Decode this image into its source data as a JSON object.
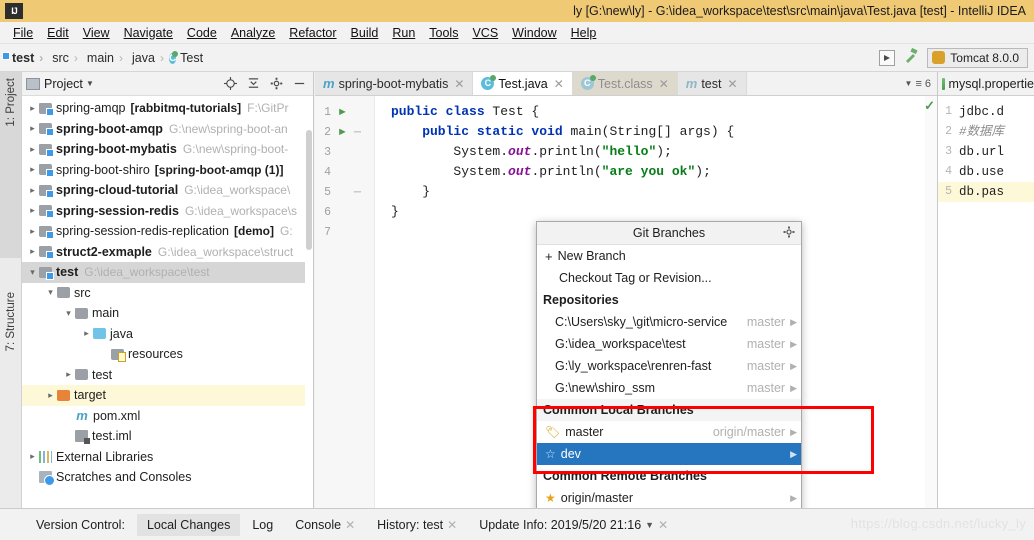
{
  "window": {
    "title": "ly [G:\\new\\ly] - G:\\idea_workspace\\test\\src\\main\\java\\Test.java [test] - IntelliJ IDEA",
    "logo": "IJ"
  },
  "menubar": {
    "items": [
      "File",
      "Edit",
      "View",
      "Navigate",
      "Code",
      "Analyze",
      "Refactor",
      "Build",
      "Run",
      "Tools",
      "VCS",
      "Window",
      "Help"
    ]
  },
  "toolbar": {
    "breadcrumbs": [
      {
        "label": "test",
        "icon": "module-folder-icon",
        "bold": true
      },
      {
        "label": "src",
        "icon": "folder-icon",
        "bold": false
      },
      {
        "label": "main",
        "icon": "folder-icon",
        "bold": false
      },
      {
        "label": "java",
        "icon": "source-folder-icon",
        "bold": false
      },
      {
        "label": "Test",
        "icon": "java-class-icon",
        "bold": false
      }
    ],
    "run_configuration": "Tomcat 8.0.0",
    "run_icon": "run-button-icon",
    "build_icon": "hammer-icon"
  },
  "sidebar_strips": {
    "project_label": "1: Project",
    "structure_label": "7: Structure"
  },
  "project_panel": {
    "header_title": "Project",
    "header_icons": [
      "locate-icon",
      "collapse-all-icon",
      "settings-gear-icon",
      "hide-icon"
    ],
    "tree": [
      {
        "indent": 0,
        "arrow": "collapsed",
        "icon": "module-folder-icon",
        "name": "spring-amqp",
        "name_bold": false,
        "suffix": "[rabbitmq-tutorials]",
        "suffix_bold": true,
        "path": "F:\\GitPr",
        "state": "normal"
      },
      {
        "indent": 0,
        "arrow": "collapsed",
        "icon": "module-folder-icon",
        "name": "spring-boot-amqp",
        "name_bold": true,
        "suffix": "",
        "suffix_bold": false,
        "path": "G:\\new\\spring-boot-an",
        "state": "normal"
      },
      {
        "indent": 0,
        "arrow": "collapsed",
        "icon": "module-folder-icon",
        "name": "spring-boot-mybatis",
        "name_bold": true,
        "suffix": "",
        "suffix_bold": false,
        "path": "G:\\new\\spring-boot-",
        "state": "normal"
      },
      {
        "indent": 0,
        "arrow": "collapsed",
        "icon": "module-folder-icon",
        "name": "spring-boot-shiro",
        "name_bold": false,
        "suffix": "[spring-boot-amqp (1)]",
        "suffix_bold": true,
        "path": "",
        "state": "normal"
      },
      {
        "indent": 0,
        "arrow": "collapsed",
        "icon": "module-folder-icon",
        "name": "spring-cloud-tutorial",
        "name_bold": true,
        "suffix": "",
        "suffix_bold": false,
        "path": "G:\\idea_workspace\\",
        "state": "normal"
      },
      {
        "indent": 0,
        "arrow": "collapsed",
        "icon": "module-folder-icon",
        "name": "spring-session-redis",
        "name_bold": true,
        "suffix": "",
        "suffix_bold": false,
        "path": "G:\\idea_workspace\\s",
        "state": "normal"
      },
      {
        "indent": 0,
        "arrow": "collapsed",
        "icon": "module-folder-icon",
        "name": "spring-session-redis-replication",
        "name_bold": false,
        "suffix": "[demo]",
        "suffix_bold": true,
        "path": "G:",
        "state": "normal"
      },
      {
        "indent": 0,
        "arrow": "collapsed",
        "icon": "module-folder-icon",
        "name": "struct2-exmaple",
        "name_bold": true,
        "suffix": "",
        "suffix_bold": false,
        "path": "G:\\idea_workspace\\struct",
        "state": "normal"
      },
      {
        "indent": 0,
        "arrow": "expanded",
        "icon": "module-folder-icon",
        "name": "test",
        "name_bold": true,
        "suffix": "",
        "suffix_bold": false,
        "path": "G:\\idea_workspace\\test",
        "state": "selected"
      },
      {
        "indent": 1,
        "arrow": "expanded",
        "icon": "folder-icon",
        "name": "src",
        "name_bold": false,
        "suffix": "",
        "suffix_bold": false,
        "path": "",
        "state": "normal"
      },
      {
        "indent": 2,
        "arrow": "expanded",
        "icon": "folder-icon",
        "name": "main",
        "name_bold": false,
        "suffix": "",
        "suffix_bold": false,
        "path": "",
        "state": "normal"
      },
      {
        "indent": 3,
        "arrow": "collapsed",
        "icon": "source-folder-icon",
        "name": "java",
        "name_bold": false,
        "suffix": "",
        "suffix_bold": false,
        "path": "",
        "state": "normal"
      },
      {
        "indent": 4,
        "arrow": "none",
        "icon": "resources-folder-icon",
        "name": "resources",
        "name_bold": false,
        "suffix": "",
        "suffix_bold": false,
        "path": "",
        "state": "normal"
      },
      {
        "indent": 2,
        "arrow": "collapsed",
        "icon": "folder-icon",
        "name": "test",
        "name_bold": false,
        "suffix": "",
        "suffix_bold": false,
        "path": "",
        "state": "normal"
      },
      {
        "indent": 1,
        "arrow": "collapsed",
        "icon": "target-folder-icon",
        "name": "target",
        "name_bold": false,
        "suffix": "",
        "suffix_bold": false,
        "path": "",
        "state": "highlighted"
      },
      {
        "indent": 2,
        "arrow": "none",
        "icon": "maven-xml-icon",
        "name": "pom.xml",
        "name_bold": false,
        "suffix": "",
        "suffix_bold": false,
        "path": "",
        "state": "normal"
      },
      {
        "indent": 2,
        "arrow": "none",
        "icon": "iml-file-icon",
        "name": "test.iml",
        "name_bold": false,
        "suffix": "",
        "suffix_bold": false,
        "path": "",
        "state": "normal"
      },
      {
        "indent": 0,
        "arrow": "collapsed",
        "icon": "libraries-icon",
        "name": "External Libraries",
        "name_bold": false,
        "suffix": "",
        "suffix_bold": false,
        "path": "",
        "state": "normal"
      },
      {
        "indent": 0,
        "arrow": "none",
        "icon": "scratches-icon",
        "name": "Scratches and Consoles",
        "name_bold": false,
        "suffix": "",
        "suffix_bold": false,
        "path": "",
        "state": "normal"
      }
    ]
  },
  "editor": {
    "tabs": [
      {
        "label": "spring-boot-mybatis",
        "icon": "maven-module-icon",
        "state": "inactive"
      },
      {
        "label": "Test.java",
        "icon": "java-class-icon",
        "state": "active"
      },
      {
        "label": "Test.class",
        "icon": "java-class-icon",
        "state": "dimmed"
      },
      {
        "label": "test",
        "icon": "maven-module-icon",
        "state": "inactive"
      }
    ],
    "tab_overflow_count": "6",
    "code_lines": [
      {
        "num": "1",
        "marker": "run-gutter-icon",
        "fold": "",
        "segments": [
          {
            "t": "public class ",
            "c": "kw"
          },
          {
            "t": "Test {",
            "c": "pln"
          }
        ]
      },
      {
        "num": "2",
        "marker": "run-gutter-icon",
        "fold": "fold-open",
        "segments": [
          {
            "t": "    public static void ",
            "c": "kw"
          },
          {
            "t": "main(String[] args) {",
            "c": "pln"
          }
        ]
      },
      {
        "num": "3",
        "marker": "",
        "fold": "",
        "segments": [
          {
            "t": "        System.",
            "c": "pln"
          },
          {
            "t": "out",
            "c": "fld"
          },
          {
            "t": ".println(",
            "c": "pln"
          },
          {
            "t": "\"hello\"",
            "c": "str"
          },
          {
            "t": ");",
            "c": "pln"
          }
        ]
      },
      {
        "num": "4",
        "marker": "",
        "fold": "",
        "segments": [
          {
            "t": "        System.",
            "c": "pln"
          },
          {
            "t": "out",
            "c": "fld"
          },
          {
            "t": ".println(",
            "c": "pln"
          },
          {
            "t": "\"are you ok\"",
            "c": "str"
          },
          {
            "t": ");",
            "c": "pln"
          }
        ]
      },
      {
        "num": "5",
        "marker": "",
        "fold": "fold-close",
        "segments": [
          {
            "t": "    }",
            "c": "pln"
          }
        ]
      },
      {
        "num": "6",
        "marker": "",
        "fold": "",
        "segments": [
          {
            "t": "}",
            "c": "pln"
          }
        ]
      },
      {
        "num": "7",
        "marker": "",
        "fold": "",
        "segments": [
          {
            "t": "",
            "c": "pln"
          }
        ]
      }
    ],
    "inspection_status": "ok-check-icon"
  },
  "right_editor": {
    "tab_label": "mysql.propertie",
    "tab_icon": "properties-file-icon",
    "lines": [
      {
        "num": "1",
        "text": "jdbc.d",
        "comment": false,
        "highlight": false
      },
      {
        "num": "2",
        "text": "#数据库",
        "comment": true,
        "highlight": false
      },
      {
        "num": "3",
        "text": "db.url",
        "comment": false,
        "highlight": false
      },
      {
        "num": "4",
        "text": "db.use",
        "comment": false,
        "highlight": false
      },
      {
        "num": "5",
        "text": "db.pas",
        "comment": false,
        "highlight": true
      }
    ]
  },
  "git_popup": {
    "title": "Git Branches",
    "settings_icon": "gear-icon",
    "actions": [
      {
        "label": "New Branch",
        "icon": "plus-icon"
      },
      {
        "label": "Checkout Tag or Revision...",
        "icon": ""
      }
    ],
    "repositories_header": "Repositories",
    "repositories": [
      {
        "path": "C:\\Users\\sky_\\git\\micro-service",
        "branch": "master"
      },
      {
        "path": "G:\\idea_workspace\\test",
        "branch": "master"
      },
      {
        "path": "G:\\ly_workspace\\renren-fast",
        "branch": "master"
      },
      {
        "path": "G:\\new\\shiro_ssm",
        "branch": "master"
      }
    ],
    "local_header": "Common Local Branches",
    "local_branches": [
      {
        "label": "master",
        "icon": "tag-icon",
        "tracking": "origin/master",
        "selected": false
      },
      {
        "label": "dev",
        "icon": "star-outline-icon",
        "tracking": "",
        "selected": true
      }
    ],
    "remote_header": "Common Remote Branches",
    "remote_branches": [
      {
        "label": "origin/master",
        "icon": "star-filled-icon",
        "tracking": "",
        "selected": false
      }
    ],
    "highlight_color": "#ff0000"
  },
  "statusbar": {
    "label": "Version Control:",
    "items": [
      {
        "label": "Local Changes",
        "active": true,
        "closable": false,
        "caret": false
      },
      {
        "label": "Log",
        "active": false,
        "closable": false,
        "caret": false
      },
      {
        "label": "Console",
        "active": false,
        "closable": true,
        "caret": false
      },
      {
        "label": "History: test",
        "active": false,
        "closable": true,
        "caret": false
      },
      {
        "label": "Update Info: 2019/5/20 21:16",
        "active": false,
        "closable": true,
        "caret": true
      }
    ]
  },
  "watermark": "https://blog.csdn.net/lucky_ly"
}
